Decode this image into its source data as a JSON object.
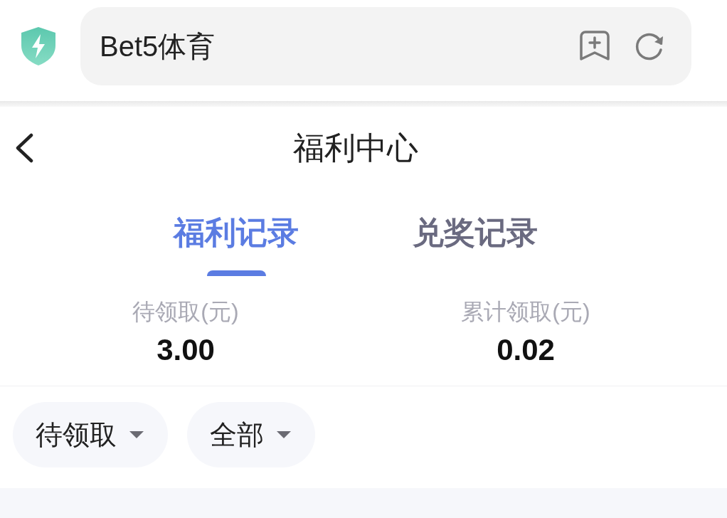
{
  "browser": {
    "address": "Bet5体育"
  },
  "header": {
    "title": "福利中心"
  },
  "tabs": [
    {
      "label": "福利记录",
      "selected": true
    },
    {
      "label": "兑奖记录",
      "selected": false
    }
  ],
  "stats": [
    {
      "label": "待领取(元)",
      "value": "3.00"
    },
    {
      "label": "累计领取(元)",
      "value": "0.02"
    }
  ],
  "filters": [
    {
      "label": "待领取"
    },
    {
      "label": "全部"
    }
  ]
}
